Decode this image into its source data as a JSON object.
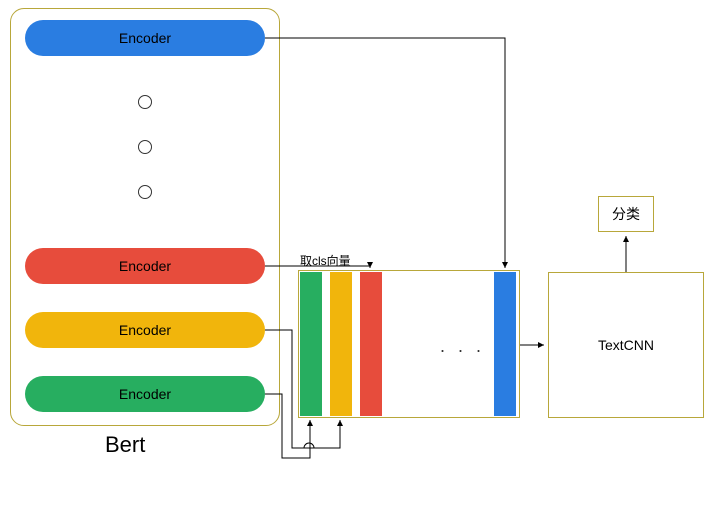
{
  "bert": {
    "label": "Bert",
    "encoders": [
      {
        "label": "Encoder",
        "color": "#2a7de1"
      },
      {
        "label": "Encoder",
        "color": "#e74c3c"
      },
      {
        "label": "Encoder",
        "color": "#f1b50c"
      },
      {
        "label": "Encoder",
        "color": "#27ae60"
      }
    ]
  },
  "annotation": {
    "cls": "取cls向量"
  },
  "vectors": {
    "bars": [
      {
        "color": "#27ae60"
      },
      {
        "color": "#f1b50c"
      },
      {
        "color": "#e74c3c"
      },
      {
        "color": "#2a7de1"
      }
    ],
    "ellipsis": ". . ."
  },
  "textcnn": {
    "label": "TextCNN"
  },
  "output": {
    "label": "分类"
  }
}
